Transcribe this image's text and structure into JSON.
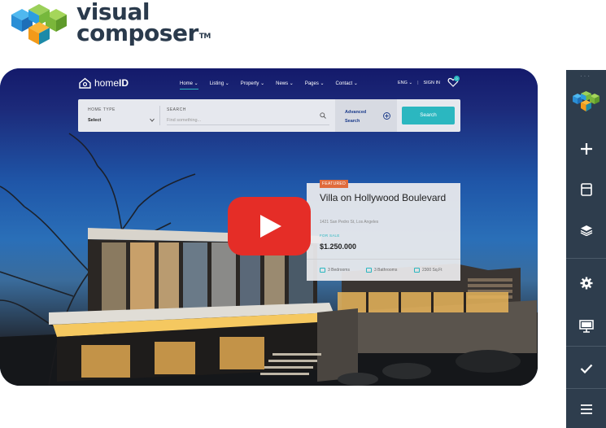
{
  "logo": {
    "line1": "visual",
    "line2": "composer",
    "trademark": "TM",
    "colors": {
      "blue": "#2a9de0",
      "green": "#8bc23f",
      "orange": "#f7a21b",
      "teal": "#1c8aa8"
    }
  },
  "preview": {
    "brand": {
      "name_light": "home",
      "name_bold": "ID"
    },
    "nav": [
      {
        "label": "Home ⌄"
      },
      {
        "label": "Listing ⌄"
      },
      {
        "label": "Property ⌄"
      },
      {
        "label": "News ⌄"
      },
      {
        "label": "Pages ⌄"
      },
      {
        "label": "Contact ⌄"
      }
    ],
    "lang": "ENG ⌄",
    "signin": "SIGN IN",
    "wishlist_count": "0",
    "search": {
      "home_type_label": "HOME TYPE",
      "home_type_value": "Select",
      "search_label": "SEARCH",
      "search_placeholder": "Find something...",
      "advanced_line1": "Advanced",
      "advanced_line2": "Search",
      "button": "Search"
    },
    "listing": {
      "badge": "FEATURED",
      "title": "Villa on Hollywood Boulevard",
      "address": "1421 San Pedro St, Los Angeles",
      "status": "FOR SALE",
      "price": "$1.250.000",
      "bedrooms": "3 Bedrooms",
      "bathrooms": "3 Bathrooms",
      "area": "2300 Sq.Ft"
    },
    "accent_color": "#2bb7c0",
    "play_button_color": "#e52d27"
  },
  "toolbar": {
    "items": [
      {
        "icon": "vc-logo-icon"
      },
      {
        "icon": "plus-icon"
      },
      {
        "icon": "layout-icon"
      },
      {
        "icon": "layers-icon"
      },
      {
        "icon": "gear-icon"
      },
      {
        "icon": "monitor-icon"
      },
      {
        "icon": "check-icon"
      },
      {
        "icon": "menu-icon"
      }
    ],
    "background": "#2e3d4d"
  }
}
